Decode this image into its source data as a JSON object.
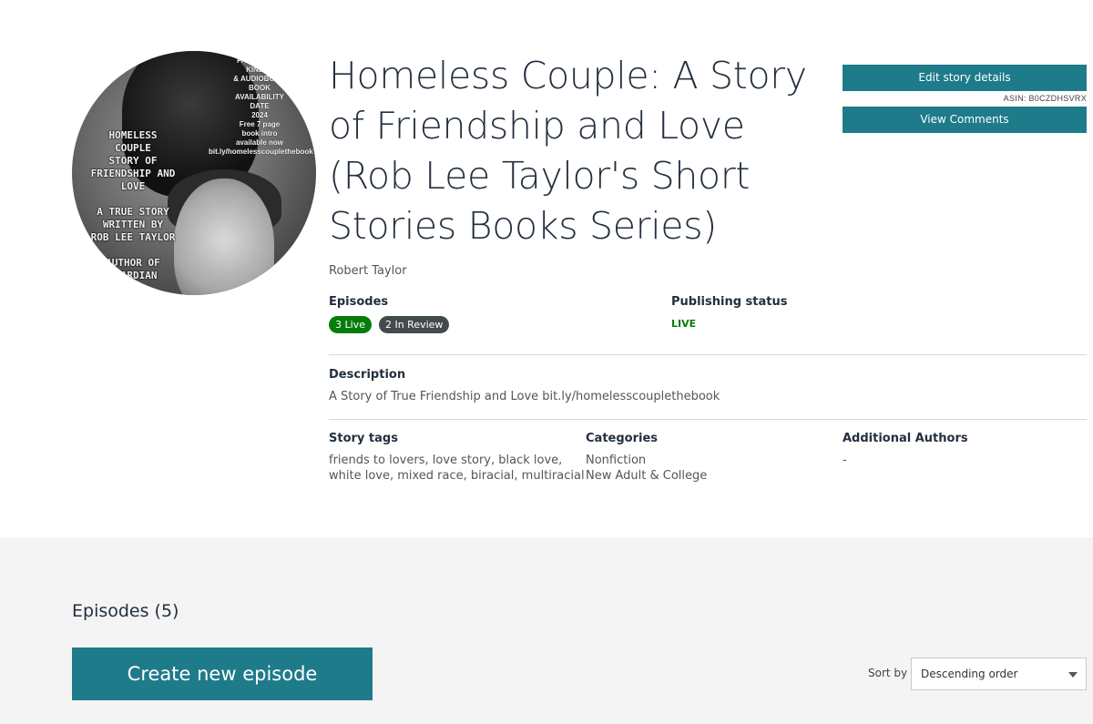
{
  "story": {
    "title": "Homeless Couple: A Story of Friendship and Love (Rob Lee Taylor's Short Stories Books Series)",
    "author": "Robert Taylor",
    "cover": {
      "left_text_1": "HOMELESS\nCOUPLE\nSTORY OF\nFRIENDSHIP AND\nLOVE",
      "left_text_2": "A TRUE STORY\nWRITTEN BY\nROB LEE TAYLOR\n\nAUTHOR OF\nGUARDIAN",
      "right_text": "PAPERBACK\nKINDLE\n& AUDIOBOOK\nBOOK\nAVAILABILITY\nDATE\n2024\nFree 7 page\nbook intro\navailable now\nbit.ly/homelesscouplethebook"
    }
  },
  "actions": {
    "edit_label": "Edit story details",
    "asin": "ASIN: B0CZDHSVRX",
    "comments_label": "View Comments"
  },
  "episodes_info": {
    "label": "Episodes",
    "live_badge": "3 Live",
    "review_badge": "2 In Review"
  },
  "publishing": {
    "label": "Publishing status",
    "value": "LIVE"
  },
  "description": {
    "label": "Description",
    "text": "A Story of True Friendship and Love bit.ly/homelesscouplethebook"
  },
  "tags": {
    "label": "Story tags",
    "value": "friends to lovers, love story, black love,\nwhite love, mixed race, biracial, multiracial"
  },
  "categories": {
    "label": "Categories",
    "value": "Nonfiction\nNew Adult & College"
  },
  "additional_authors": {
    "label": "Additional Authors",
    "value": "-"
  },
  "episodes_section": {
    "heading": "Episodes (5)",
    "create_label": "Create new episode",
    "sort_label": "Sort by",
    "sort_value": "Descending order"
  },
  "colors": {
    "accent": "#1e7b8a",
    "live_green": "#067d0a",
    "review_gray": "#444b4f",
    "section_bg": "#f4f4f4"
  }
}
